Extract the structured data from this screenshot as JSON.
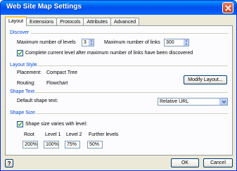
{
  "window": {
    "title": "Web Site Map Settings"
  },
  "tabs": [
    {
      "label": "Layout"
    },
    {
      "label": "Extensions"
    },
    {
      "label": "Protocols"
    },
    {
      "label": "Attributes"
    },
    {
      "label": "Advanced"
    }
  ],
  "discover": {
    "heading": "Discover",
    "max_levels_label": "Maximum number of levels",
    "max_levels_value": "3",
    "max_links_label": "Maximum number of links",
    "max_links_value": "300",
    "complete_level_label": "Complete current level after maximum number of links have been discovered"
  },
  "layout_style": {
    "heading": "Layout Style",
    "placement_label": "Placement:",
    "placement_value": "Compact Tree",
    "routing_label": "Routing:",
    "routing_value": "Flowchart",
    "modify_button": "Modify Layout..."
  },
  "shape_text": {
    "heading": "Shape Text",
    "default_label": "Default shape text:",
    "default_value": "Relative URL"
  },
  "shape_size": {
    "heading": "Shape Size",
    "varies_label": "Shape size varies with level:",
    "levels": [
      {
        "label": "Root",
        "value": "200%"
      },
      {
        "label": "Level 1",
        "value": "100%"
      },
      {
        "label": "Level 2",
        "value": "75%"
      },
      {
        "label": "Further levels",
        "value": "50%"
      }
    ]
  },
  "footer": {
    "ok_label": "OK",
    "cancel_label": "Cancel",
    "help_icon": "question-mark-icon"
  },
  "colors": {
    "titlebar": "#0053ee",
    "section_heading": "#0046d5",
    "dialog_bg": "#ece9d8"
  }
}
